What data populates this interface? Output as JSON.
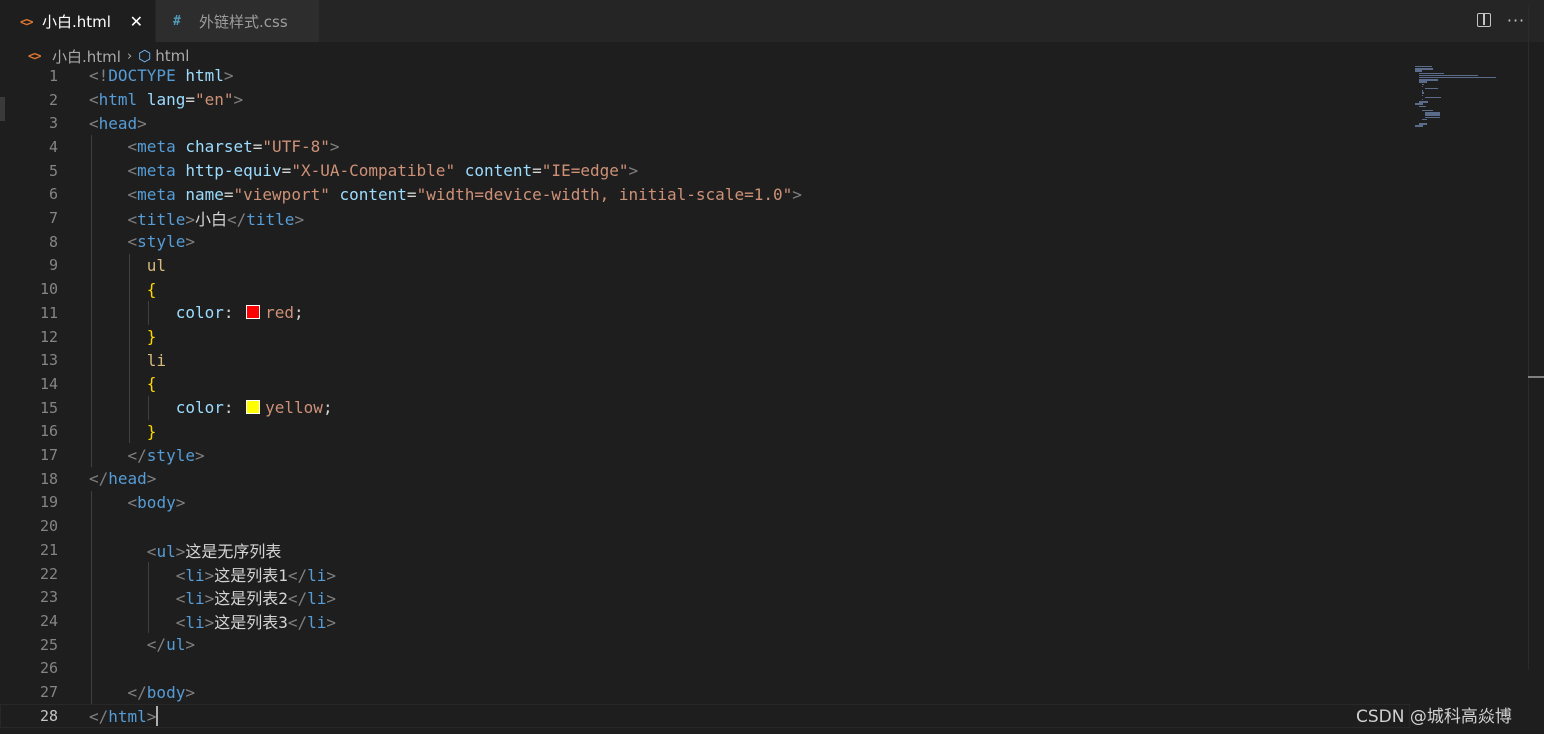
{
  "tabs": [
    {
      "label": "小白.html",
      "icon": "html-file-icon",
      "active": true,
      "close": "✕"
    },
    {
      "label": "外链样式.css",
      "icon": "css-file-icon",
      "active": false
    }
  ],
  "tab_icons": {
    "html": "<>",
    "css": "#"
  },
  "actions": {
    "more": "···"
  },
  "breadcrumb": {
    "file": "小白.html",
    "sep": "›",
    "symbol_icon": "⬡",
    "symbol": "html"
  },
  "lines": [
    {
      "num": "1",
      "tokens": [
        [
          "p",
          "<!"
        ],
        [
          "t",
          "DOCTYPE"
        ],
        [
          "x",
          " "
        ],
        [
          "a",
          "html"
        ],
        [
          "p",
          ">"
        ]
      ]
    },
    {
      "num": "2",
      "tokens": [
        [
          "p",
          "<"
        ],
        [
          "t",
          "html"
        ],
        [
          "x",
          " "
        ],
        [
          "a",
          "lang"
        ],
        [
          "x",
          "="
        ],
        [
          "v",
          "\"en\""
        ],
        [
          "p",
          ">"
        ]
      ]
    },
    {
      "num": "3",
      "tokens": [
        [
          "p",
          "<"
        ],
        [
          "t",
          "head"
        ],
        [
          "p",
          ">"
        ]
      ]
    },
    {
      "num": "4",
      "tokens": [
        [
          "x",
          "    "
        ],
        [
          "p",
          "<"
        ],
        [
          "t",
          "meta"
        ],
        [
          "x",
          " "
        ],
        [
          "a",
          "charset"
        ],
        [
          "x",
          "="
        ],
        [
          "v",
          "\"UTF-8\""
        ],
        [
          "p",
          ">"
        ]
      ]
    },
    {
      "num": "5",
      "tokens": [
        [
          "x",
          "    "
        ],
        [
          "p",
          "<"
        ],
        [
          "t",
          "meta"
        ],
        [
          "x",
          " "
        ],
        [
          "a",
          "http-equiv"
        ],
        [
          "x",
          "="
        ],
        [
          "v",
          "\"X-UA-Compatible\""
        ],
        [
          "x",
          " "
        ],
        [
          "a",
          "content"
        ],
        [
          "x",
          "="
        ],
        [
          "v",
          "\"IE=edge\""
        ],
        [
          "p",
          ">"
        ]
      ]
    },
    {
      "num": "6",
      "tokens": [
        [
          "x",
          "    "
        ],
        [
          "p",
          "<"
        ],
        [
          "t",
          "meta"
        ],
        [
          "x",
          " "
        ],
        [
          "a",
          "name"
        ],
        [
          "x",
          "="
        ],
        [
          "v",
          "\"viewport\""
        ],
        [
          "x",
          " "
        ],
        [
          "a",
          "content"
        ],
        [
          "x",
          "="
        ],
        [
          "v",
          "\"width=device-width, initial-scale=1.0\""
        ],
        [
          "p",
          ">"
        ]
      ]
    },
    {
      "num": "7",
      "tokens": [
        [
          "x",
          "    "
        ],
        [
          "p",
          "<"
        ],
        [
          "t",
          "title"
        ],
        [
          "p",
          ">"
        ],
        [
          "x",
          "小白"
        ],
        [
          "p",
          "</"
        ],
        [
          "t",
          "title"
        ],
        [
          "p",
          ">"
        ]
      ]
    },
    {
      "num": "8",
      "tokens": [
        [
          "x",
          "    "
        ],
        [
          "p",
          "<"
        ],
        [
          "t",
          "style"
        ],
        [
          "p",
          ">"
        ]
      ]
    },
    {
      "num": "9",
      "tokens": [
        [
          "x",
          "      "
        ],
        [
          "s",
          "ul"
        ]
      ]
    },
    {
      "num": "10",
      "tokens": [
        [
          "x",
          "      "
        ],
        [
          "b",
          "{"
        ]
      ]
    },
    {
      "num": "11",
      "tokens": [
        [
          "x",
          "         "
        ],
        [
          "a",
          "color"
        ],
        [
          "x",
          ": "
        ],
        [
          "sw",
          "#ff0000"
        ],
        [
          "v",
          "red"
        ],
        [
          "x",
          ";"
        ]
      ]
    },
    {
      "num": "12",
      "tokens": [
        [
          "x",
          "      "
        ],
        [
          "b",
          "}"
        ]
      ]
    },
    {
      "num": "13",
      "tokens": [
        [
          "x",
          "      "
        ],
        [
          "s",
          "li"
        ]
      ]
    },
    {
      "num": "14",
      "tokens": [
        [
          "x",
          "      "
        ],
        [
          "b",
          "{"
        ]
      ]
    },
    {
      "num": "15",
      "tokens": [
        [
          "x",
          "         "
        ],
        [
          "a",
          "color"
        ],
        [
          "x",
          ": "
        ],
        [
          "sw",
          "#ffff00"
        ],
        [
          "v",
          "yellow"
        ],
        [
          "x",
          ";"
        ]
      ]
    },
    {
      "num": "16",
      "tokens": [
        [
          "x",
          "      "
        ],
        [
          "b",
          "}"
        ]
      ]
    },
    {
      "num": "17",
      "tokens": [
        [
          "x",
          "    "
        ],
        [
          "p",
          "</"
        ],
        [
          "t",
          "style"
        ],
        [
          "p",
          ">"
        ]
      ]
    },
    {
      "num": "18",
      "tokens": [
        [
          "p",
          "</"
        ],
        [
          "t",
          "head"
        ],
        [
          "p",
          ">"
        ]
      ]
    },
    {
      "num": "19",
      "tokens": [
        [
          "x",
          "    "
        ],
        [
          "p",
          "<"
        ],
        [
          "t",
          "body"
        ],
        [
          "p",
          ">"
        ]
      ]
    },
    {
      "num": "20",
      "tokens": []
    },
    {
      "num": "21",
      "tokens": [
        [
          "x",
          "      "
        ],
        [
          "p",
          "<"
        ],
        [
          "t",
          "ul"
        ],
        [
          "p",
          ">"
        ],
        [
          "x",
          "这是无序列表"
        ]
      ]
    },
    {
      "num": "22",
      "tokens": [
        [
          "x",
          "         "
        ],
        [
          "p",
          "<"
        ],
        [
          "t",
          "li"
        ],
        [
          "p",
          ">"
        ],
        [
          "x",
          "这是列表1"
        ],
        [
          "p",
          "</"
        ],
        [
          "t",
          "li"
        ],
        [
          "p",
          ">"
        ]
      ]
    },
    {
      "num": "23",
      "tokens": [
        [
          "x",
          "         "
        ],
        [
          "p",
          "<"
        ],
        [
          "t",
          "li"
        ],
        [
          "p",
          ">"
        ],
        [
          "x",
          "这是列表2"
        ],
        [
          "p",
          "</"
        ],
        [
          "t",
          "li"
        ],
        [
          "p",
          ">"
        ]
      ]
    },
    {
      "num": "24",
      "tokens": [
        [
          "x",
          "         "
        ],
        [
          "p",
          "<"
        ],
        [
          "t",
          "li"
        ],
        [
          "p",
          ">"
        ],
        [
          "x",
          "这是列表3"
        ],
        [
          "p",
          "</"
        ],
        [
          "t",
          "li"
        ],
        [
          "p",
          ">"
        ]
      ]
    },
    {
      "num": "25",
      "tokens": [
        [
          "x",
          "      "
        ],
        [
          "p",
          "</"
        ],
        [
          "t",
          "ul"
        ],
        [
          "p",
          ">"
        ]
      ]
    },
    {
      "num": "26",
      "tokens": []
    },
    {
      "num": "27",
      "tokens": [
        [
          "x",
          "    "
        ],
        [
          "p",
          "</"
        ],
        [
          "t",
          "body"
        ],
        [
          "p",
          ">"
        ]
      ]
    },
    {
      "num": "28",
      "tokens": [
        [
          "p",
          "</"
        ],
        [
          "t",
          "html"
        ],
        [
          "p",
          ">"
        ]
      ],
      "current": true
    }
  ],
  "colors": {
    "tag": "#569cd6",
    "attr": "#9cdcfe",
    "value": "#ce9178",
    "selector": "#d7ba7d",
    "brace": "#ffd700",
    "punct": "#808080"
  },
  "watermark": "CSDN @城科高焱博"
}
